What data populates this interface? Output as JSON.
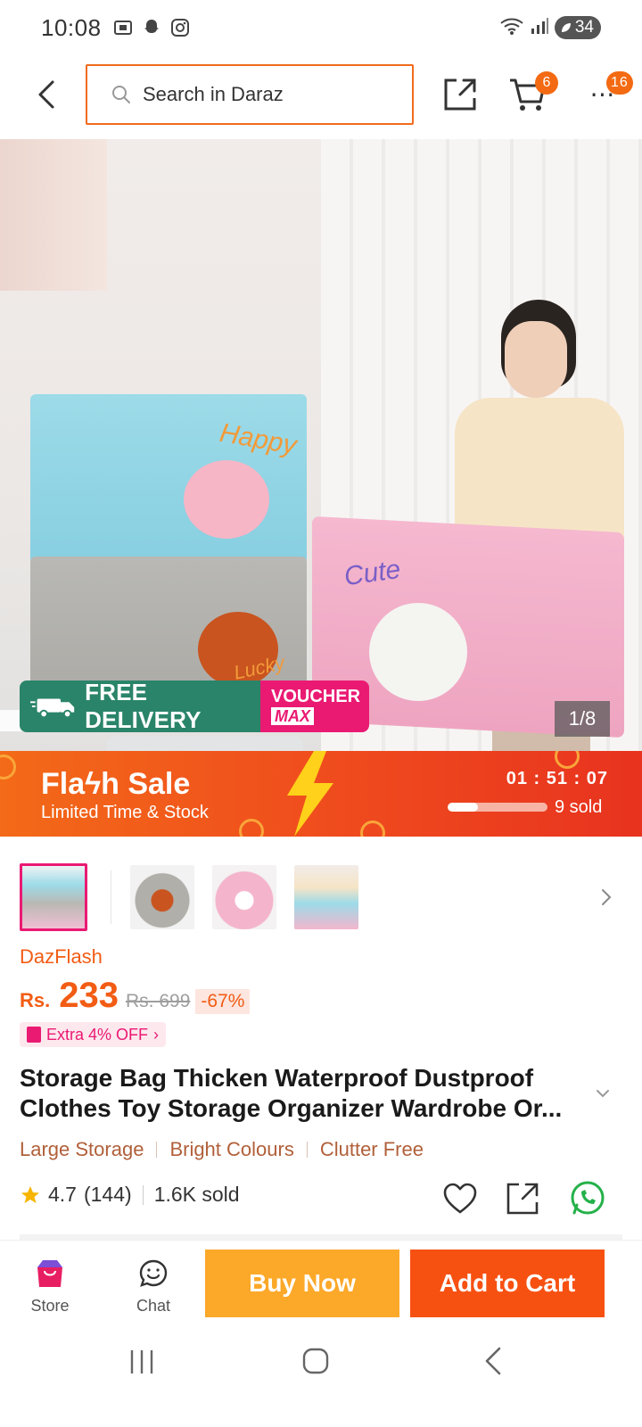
{
  "status_bar": {
    "time": "10:08",
    "battery": "34",
    "left_icons": [
      "screenshot-icon",
      "snapchat-icon",
      "instagram-icon"
    ],
    "right_icons": [
      "wifi-icon",
      "signal-icon",
      "battery-icon"
    ]
  },
  "header": {
    "search_placeholder": "Search in Daraz",
    "cart_badge": "6",
    "more_badge": "16",
    "more_label": "⋯",
    "accent_color": "#f26b1c"
  },
  "hero": {
    "delivery_text": "FREE DELIVERY",
    "voucher_line1": "VOUCHER",
    "voucher_line2": "MAX",
    "image_counter": "1/8",
    "box_labels": {
      "happy": "Happy",
      "cute": "Cute",
      "lucky": "Lucky"
    }
  },
  "flash_sale": {
    "title": "Flaϟh  Sale",
    "subtitle": "Limited Time & Stock",
    "timer": "01 : 51 : 07",
    "sold": "9 sold",
    "sold_progress": 0.3
  },
  "product": {
    "store_label": "DazFlash",
    "currency": "Rs.",
    "price": "233",
    "old_price": "Rs. 699",
    "discount": "-67%",
    "extra_off": "Extra 4% OFF",
    "title_line1": "Storage Bag Thicken Waterproof Dustproof",
    "title_line2": "Clothes Toy Storage Organizer Wardrobe Or...",
    "tags": [
      "Large Storage",
      "Bright Colours",
      "Clutter Free"
    ],
    "rating": "4.7",
    "review_count": "(144)",
    "sold_count": "1.6K sold"
  },
  "action_bar": {
    "store_label": "Store",
    "chat_label": "Chat",
    "buy_now_label": "Buy Now",
    "add_to_cart_label": "Add to Cart",
    "buy_color": "#fca829",
    "cart_color": "#f75112"
  }
}
